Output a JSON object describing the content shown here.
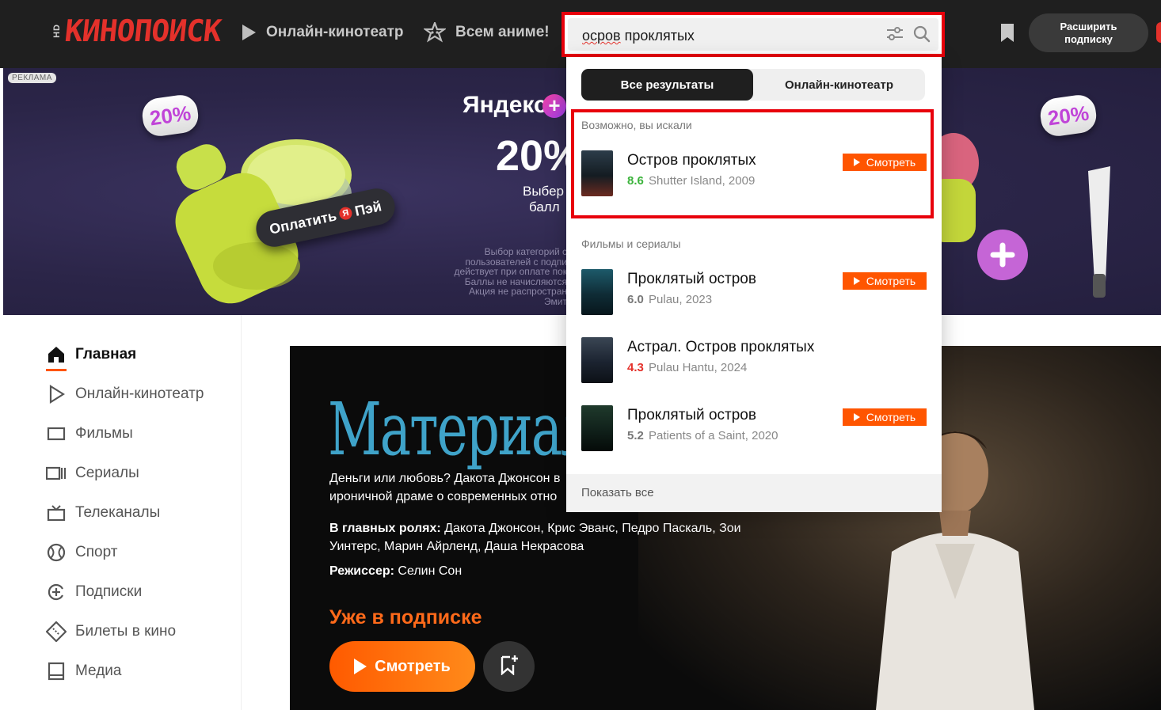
{
  "header": {
    "logo_hd": "HD",
    "logo_text": "КИНОПОИСК",
    "nav": [
      {
        "label": "Онлайн-кинотеатр",
        "icon": "play-icon"
      },
      {
        "label": "Всем аниме!",
        "icon": "anime-star-icon"
      }
    ],
    "search": {
      "query_misspelled": "осров",
      "query_rest": " проклятых",
      "filter_icon": "filter-icon",
      "search_icon": "search-icon"
    },
    "bookmark_icon": "bookmark-icon",
    "extend_line1": "Расширить",
    "extend_line2": "подписку"
  },
  "ad": {
    "badge": "РЕКЛАМА",
    "percent_tag": "20%",
    "brand": "Яндекс",
    "plus": "+",
    "big": "20%",
    "sub_line1": "Выбер",
    "sub_line2": "балл",
    "pay_button_pre": "Оплатить",
    "pay_button_ya": "Я",
    "pay_button_post": "Пэй",
    "fine_print": [
      "Выбор категорий с",
      "пользователей с подпи",
      "действует при оплате пок",
      "Баллы не начисляются",
      "Акция не распростран",
      "Эмит"
    ]
  },
  "sidebar": {
    "items": [
      {
        "label": "Главная",
        "icon": "home-icon",
        "active": true
      },
      {
        "label": "Онлайн-кинотеатр",
        "icon": "play-icon"
      },
      {
        "label": "Фильмы",
        "icon": "film-icon"
      },
      {
        "label": "Сериалы",
        "icon": "series-icon"
      },
      {
        "label": "Телеканалы",
        "icon": "tv-icon"
      },
      {
        "label": "Спорт",
        "icon": "sport-icon"
      },
      {
        "label": "Подписки",
        "icon": "subscription-icon"
      },
      {
        "label": "Билеты в кино",
        "icon": "ticket-icon"
      },
      {
        "label": "Медиа",
        "icon": "media-icon"
      }
    ]
  },
  "hero": {
    "title": "Материалисты",
    "desc_line1": "Деньги или любовь? Дакота Джонсон в",
    "desc_line2": "ироничной драме о современных отно",
    "cast_label": "В главных ролях:",
    "cast": "Дакота Джонсон, Крис Эванс, Педро Паскаль, Зои Уинтерс, Марин Айрленд, Даша Некрасова",
    "director_label": "Режиссер:",
    "director": "Селин Сон",
    "subscription_label": "Уже в подписке",
    "watch_label": "Смотреть"
  },
  "dropdown": {
    "tabs": [
      {
        "label": "Все результаты",
        "active": true
      },
      {
        "label": "Онлайн-кинотеатр",
        "active": false
      }
    ],
    "maybe_label": "Возможно, вы искали",
    "top_result": {
      "title": "Остров проклятых",
      "rating": "8.6",
      "rating_color": "#3bb33b",
      "meta": "Shutter Island, 2009",
      "watch": "Смотреть"
    },
    "films_label": "Фильмы и сериалы",
    "results": [
      {
        "title": "Проклятый остров",
        "rating": "6.0",
        "rating_color": "#777777",
        "meta": "Pulau, 2023",
        "watch": "Смотреть"
      },
      {
        "title": "Астрал. Остров проклятых",
        "rating": "4.3",
        "rating_color": "#e4312b",
        "meta": "Pulau Hantu, 2024",
        "watch": ""
      },
      {
        "title": "Проклятый остров",
        "rating": "5.2",
        "rating_color": "#777777",
        "meta": "Patients of a Saint, 2020",
        "watch": "Смотреть"
      }
    ],
    "show_all": "Показать все"
  },
  "colors": {
    "accent": "#ff5500",
    "highlight": "#e8000b",
    "header_bg": "#1f1f1f"
  }
}
